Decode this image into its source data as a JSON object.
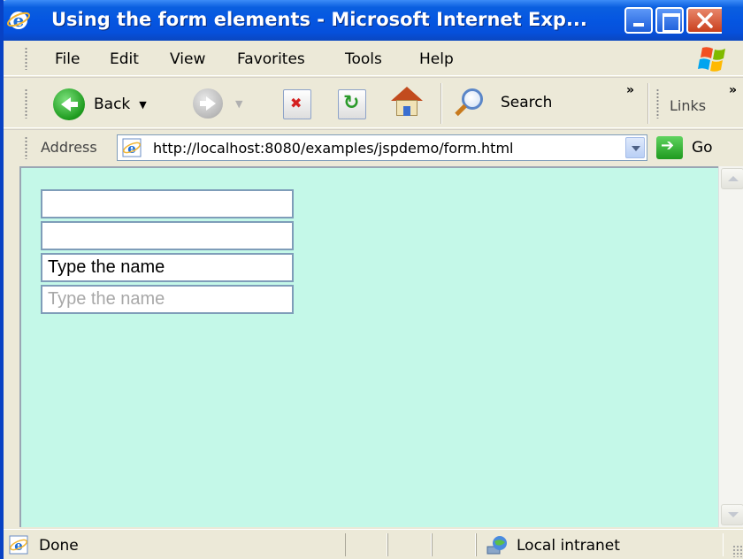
{
  "window": {
    "title": "Using the form elements - Microsoft Internet Exp..."
  },
  "menu": {
    "items": [
      {
        "label": "File"
      },
      {
        "label": "Edit"
      },
      {
        "label": "View"
      },
      {
        "label": "Favorites"
      },
      {
        "label": "Tools"
      },
      {
        "label": "Help"
      }
    ]
  },
  "toolbar": {
    "back_label": "Back",
    "search_label": "Search",
    "links_label": "Links",
    "chevron": "»"
  },
  "address": {
    "label": "Address",
    "url": "http://localhost:8080/examples/jspdemo/form.html",
    "go_label": "Go"
  },
  "form": {
    "field1_value": "",
    "field2_value": "",
    "field3_value": "Type the name",
    "field4_placeholder": "Type the name"
  },
  "status": {
    "text": "Done",
    "zone": "Local intranet"
  },
  "colors": {
    "titlebar": "#0556E1",
    "content_bg": "#C4F8E8",
    "chrome": "#ECE9D8"
  }
}
